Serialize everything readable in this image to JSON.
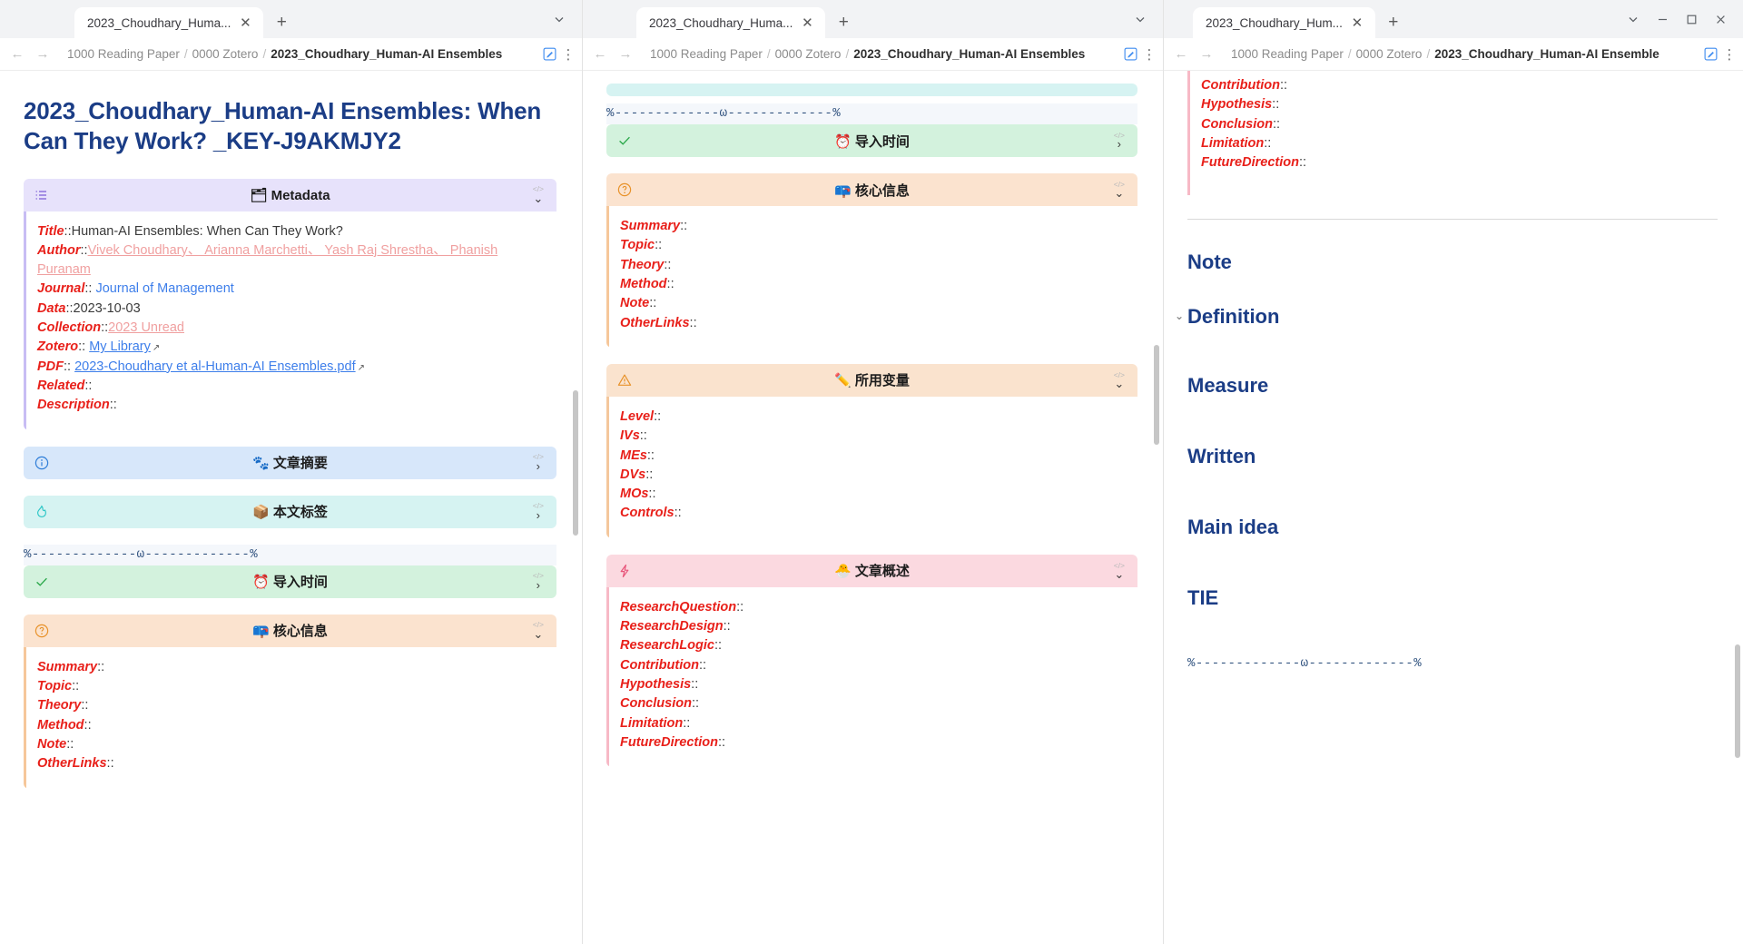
{
  "windows": [
    {
      "tab_label": "2023_Choudhary_Huma...",
      "breadcrumb": {
        "root": "1000 Reading Paper",
        "folder": "0000 Zotero",
        "current": "2023_Choudhary_Human-AI Ensembles"
      }
    },
    {
      "tab_label": "2023_Choudhary_Huma...",
      "breadcrumb": {
        "root": "1000 Reading Paper",
        "folder": "0000 Zotero",
        "current": "2023_Choudhary_Human-AI Ensembles"
      }
    },
    {
      "tab_label": "2023_Choudhary_Hum...",
      "breadcrumb": {
        "root": "1000 Reading Paper",
        "folder": "0000 Zotero",
        "current": "2023_Choudhary_Human-AI Ensemble"
      }
    }
  ],
  "icons": {
    "tab_close": "close-icon",
    "tab_new": "new-tab-icon",
    "chevron_down": "chevron-down-icon",
    "minimize": "minimize-icon",
    "maximize": "maximize-icon",
    "window_close": "window-close-icon",
    "back": "back-arrow-icon",
    "forward": "forward-arrow-icon",
    "edit": "edit-pencil-icon",
    "more": "kebab-menu-icon"
  },
  "doc": {
    "title": "2023_Choudhary_Human-AI Ensembles: When Can They Work? _KEY-J9AKMJY2",
    "separator": "%-------------ω-------------%"
  },
  "callouts": {
    "metadata": {
      "title": "🗂 Metadata",
      "icon": "list-icon",
      "fold_label": "</>",
      "rows": [
        {
          "k": "Title",
          "sep": "::",
          "v": "Human-AI Ensembles: When Can They Work?",
          "style": "plain"
        },
        {
          "k": "Author",
          "sep": "::",
          "v": "Vivek Choudhary、 Arianna Marchetti、 Yash Raj Shrestha、 Phanish Puranam",
          "style": "tag"
        },
        {
          "k": "Journal",
          "sep": ":: ",
          "v": "Journal of Management",
          "style": "link"
        },
        {
          "k": "Data",
          "sep": "::",
          "v": "2023-10-03",
          "style": "plain"
        },
        {
          "k": "Collection",
          "sep": "::",
          "v": "2023 Unread",
          "style": "tag"
        },
        {
          "k": "Zotero",
          "sep": ":: ",
          "v": "My Library",
          "style": "link-u",
          "external": true
        },
        {
          "k": "PDF",
          "sep": ":: ",
          "v": "2023-Choudhary et al-Human-AI Ensembles.pdf",
          "style": "link-u",
          "external": true
        },
        {
          "k": "Related",
          "sep": "::",
          "v": "",
          "style": "plain"
        },
        {
          "k": "Description",
          "sep": "::",
          "v": "",
          "style": "plain"
        }
      ]
    },
    "abstract": {
      "title": "🐾 文章摘要",
      "icon": "info-icon",
      "fold_label": "</>"
    },
    "tags": {
      "title": "📦 本文标签",
      "icon": "flame-icon",
      "fold_label": "</>"
    },
    "import_time": {
      "title": "⏰ 导入时间",
      "icon": "check-icon",
      "fold_label": "</>"
    },
    "core_info": {
      "title": "📪 核心信息",
      "icon": "question-icon",
      "fold_label": "</>",
      "rows": [
        {
          "k": "Summary",
          "sep": "::"
        },
        {
          "k": "Topic",
          "sep": "::"
        },
        {
          "k": "Theory",
          "sep": "::"
        },
        {
          "k": "Method",
          "sep": "::"
        },
        {
          "k": "Note",
          "sep": "::"
        },
        {
          "k": "OtherLinks",
          "sep": "::"
        }
      ]
    },
    "variables": {
      "title": "✏️ 所用变量",
      "icon": "warning-icon",
      "fold_label": "</>",
      "rows": [
        {
          "k": "Level",
          "sep": "::"
        },
        {
          "k": "IVs",
          "sep": "::"
        },
        {
          "k": "MEs",
          "sep": "::"
        },
        {
          "k": "DVs",
          "sep": "::"
        },
        {
          "k": "MOs",
          "sep": "::"
        },
        {
          "k": "Controls",
          "sep": "::"
        }
      ]
    },
    "overview": {
      "title": "🐣 文章概述",
      "icon": "zap-icon",
      "fold_label": "</>",
      "rows": [
        {
          "k": "ResearchQuestion",
          "sep": "::"
        },
        {
          "k": "ResearchDesign",
          "sep": "::"
        },
        {
          "k": "ResearchLogic",
          "sep": "::"
        },
        {
          "k": "Contribution",
          "sep": "::"
        },
        {
          "k": "Hypothesis",
          "sep": "::"
        },
        {
          "k": "Conclusion",
          "sep": "::"
        },
        {
          "k": "Limitation",
          "sep": "::"
        },
        {
          "k": "FutureDirection",
          "sep": "::"
        }
      ],
      "tail_rows": [
        {
          "k": "Contribution",
          "sep": "::"
        },
        {
          "k": "Hypothesis",
          "sep": "::"
        },
        {
          "k": "Conclusion",
          "sep": "::"
        },
        {
          "k": "Limitation",
          "sep": "::"
        },
        {
          "k": "FutureDirection",
          "sep": "::"
        }
      ]
    }
  },
  "headings": [
    {
      "text": "Note",
      "folded": false
    },
    {
      "text": "Definition",
      "folded": true
    },
    {
      "text": "Measure",
      "folded": false
    },
    {
      "text": "Written",
      "folded": false
    },
    {
      "text": "Main idea",
      "folded": false
    },
    {
      "text": "TIE",
      "folded": false
    }
  ]
}
